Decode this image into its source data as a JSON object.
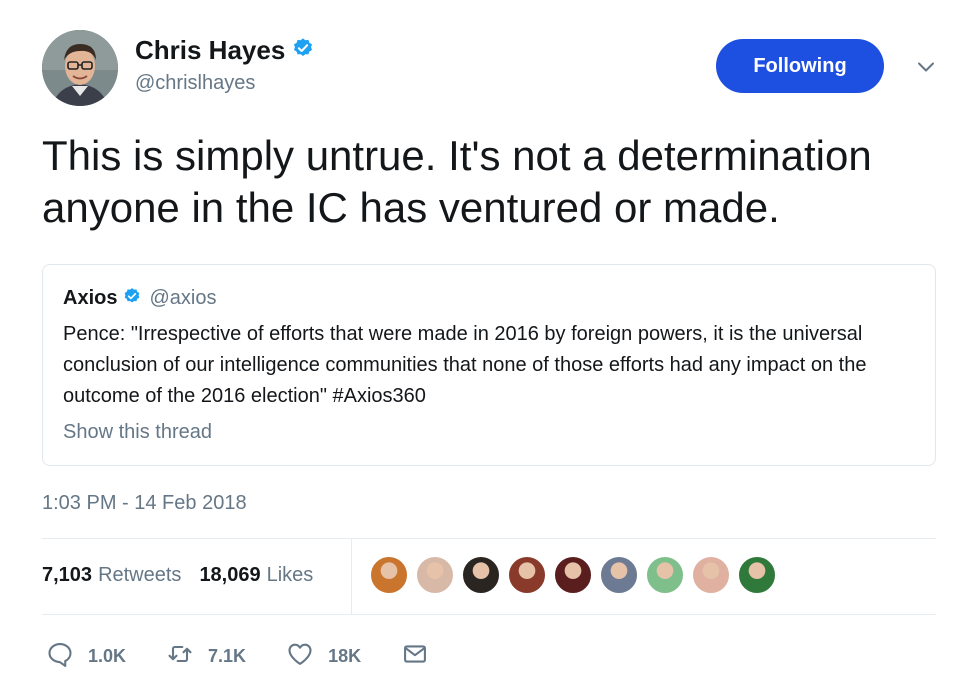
{
  "author": {
    "display_name": "Chris Hayes",
    "handle": "@chrislhayes",
    "verified": true
  },
  "follow_button": {
    "label": "Following",
    "color": "#1d4fe0"
  },
  "tweet": {
    "text": "This is simply untrue. It's not a determination anyone in the IC has ventured or made."
  },
  "quoted_tweet": {
    "display_name": "Axios",
    "handle": "@axios",
    "verified": true,
    "text": "Pence: \"Irrespective of efforts that were made in 2016 by foreign powers, it is the universal conclusion of our intelligence communities that none of those efforts had any impact on the outcome of the 2016 election\" #Axios360",
    "show_thread_label": "Show this thread"
  },
  "timestamp": "1:03 PM - 14 Feb 2018",
  "stats": {
    "retweets_count": "7,103",
    "retweets_label": "Retweets",
    "likes_count": "18,069",
    "likes_label": "Likes"
  },
  "likers_avatar_colors": [
    "#c9752e",
    "#d8b9a8",
    "#2a2520",
    "#8a3a2a",
    "#5a1e1e",
    "#6c7a93",
    "#7fbf8c",
    "#e0b0a0",
    "#2f7a3a"
  ],
  "actions": {
    "reply_count": "1.0K",
    "retweet_count": "7.1K",
    "like_count": "18K"
  },
  "colors": {
    "verified_blue": "#1da1f2",
    "secondary_text": "#657786",
    "border": "#e1e8ed"
  }
}
